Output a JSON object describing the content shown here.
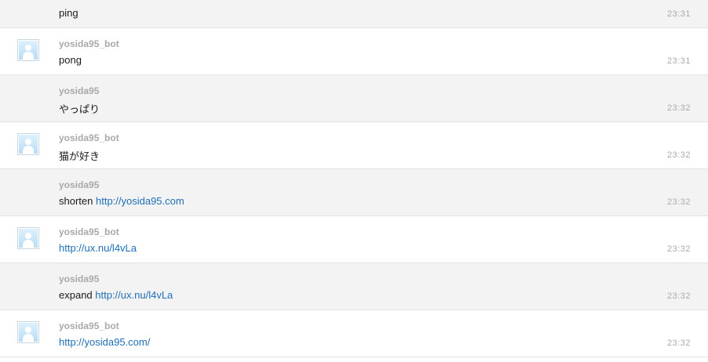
{
  "messages": [
    {
      "user": "",
      "text": "ping",
      "link": "",
      "time": "23:31",
      "bot": false
    },
    {
      "user": "yosida95_bot",
      "text": "pong",
      "link": "",
      "time": "23:31",
      "bot": true
    },
    {
      "user": "yosida95",
      "text": "やっぱり",
      "link": "",
      "time": "23:32",
      "bot": false
    },
    {
      "user": "yosida95_bot",
      "text": "猫が好き",
      "link": "",
      "time": "23:32",
      "bot": true
    },
    {
      "user": "yosida95",
      "text": "shorten ",
      "link": "http://yosida95.com",
      "time": "23:32",
      "bot": false
    },
    {
      "user": "yosida95_bot",
      "text": "",
      "link": "http://ux.nu/l4vLa",
      "time": "23:32",
      "bot": true
    },
    {
      "user": "yosida95",
      "text": "expand ",
      "link": "http://ux.nu/l4vLa",
      "time": "23:32",
      "bot": false
    },
    {
      "user": "yosida95_bot",
      "text": "",
      "link": "http://yosida95.com/",
      "time": "23:32",
      "bot": true
    }
  ]
}
